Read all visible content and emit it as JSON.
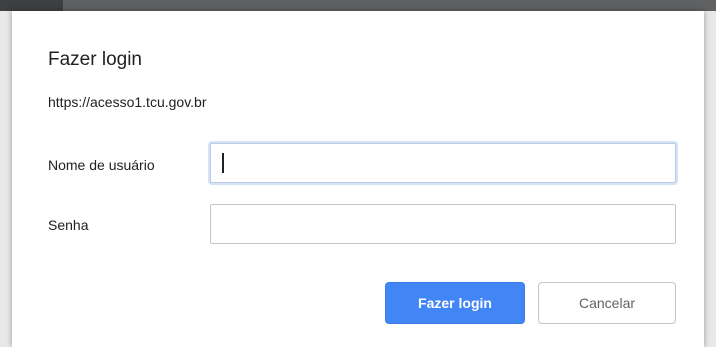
{
  "dialog": {
    "title": "Fazer login",
    "origin": "https://acesso1.tcu.gov.br",
    "username": {
      "label": "Nome de usuário",
      "value": "",
      "placeholder": ""
    },
    "password": {
      "label": "Senha",
      "value": "",
      "placeholder": ""
    },
    "buttons": {
      "submit_label": "Fazer login",
      "cancel_label": "Cancelar"
    }
  },
  "colors": {
    "primary_button": "#4285f4",
    "focus_ring": "#d6e2f5",
    "background_bar": "#5f6163"
  }
}
